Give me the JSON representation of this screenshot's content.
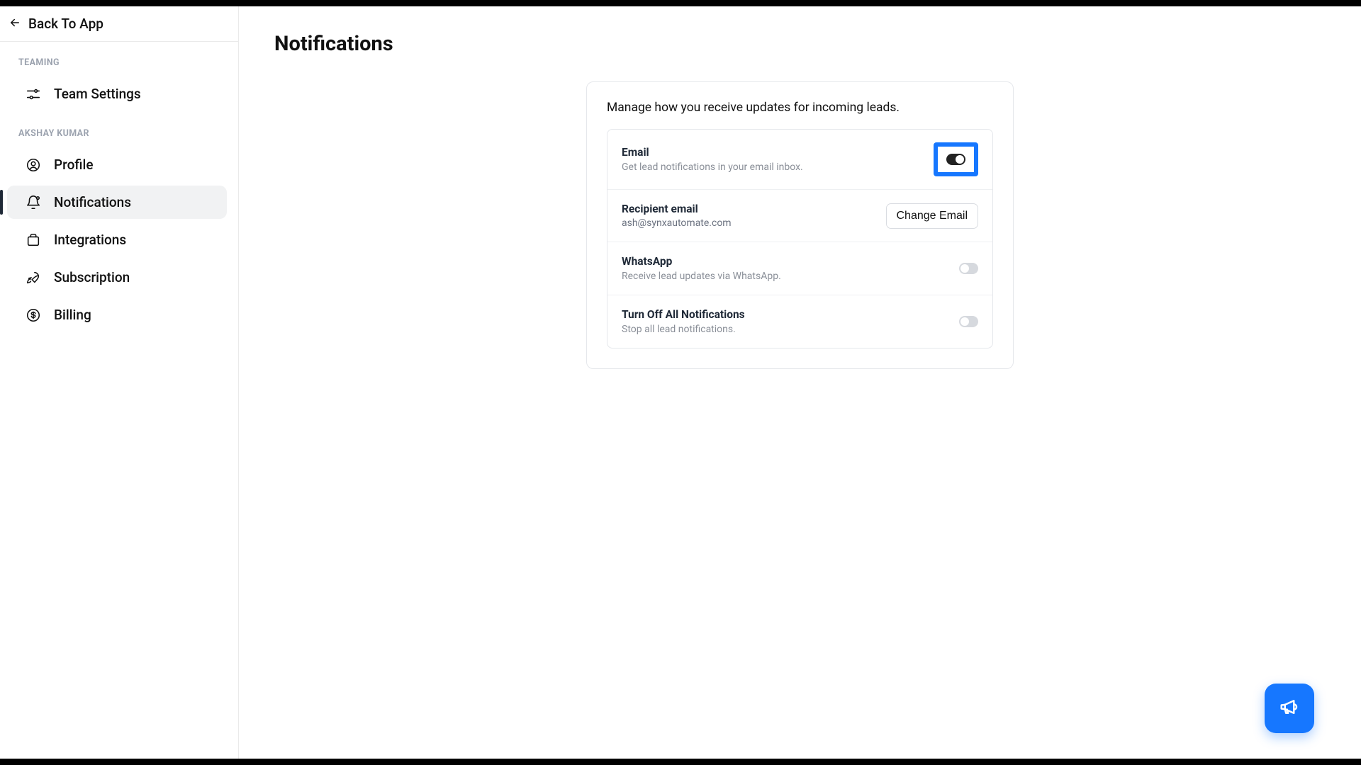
{
  "back": {
    "label": "Back To App"
  },
  "sidebar": {
    "section1": "Teaming",
    "section2": "Akshay Kumar",
    "items": {
      "team_settings": "Team Settings",
      "profile": "Profile",
      "notifications": "Notifications",
      "integrations": "Integrations",
      "subscription": "Subscription",
      "billing": "Billing"
    }
  },
  "page": {
    "title": "Notifications",
    "card_header": "Manage how you receive updates for incoming leads."
  },
  "rows": {
    "email": {
      "title": "Email",
      "sub": "Get lead notifications in your email inbox."
    },
    "recipient": {
      "title": "Recipient email",
      "value": "ash@synxautomate.com",
      "button": "Change Email"
    },
    "whatsapp": {
      "title": "WhatsApp",
      "sub": "Receive lead updates via WhatsApp."
    },
    "turnoff": {
      "title": "Turn Off All Notifications",
      "sub": "Stop all lead notifications."
    }
  }
}
